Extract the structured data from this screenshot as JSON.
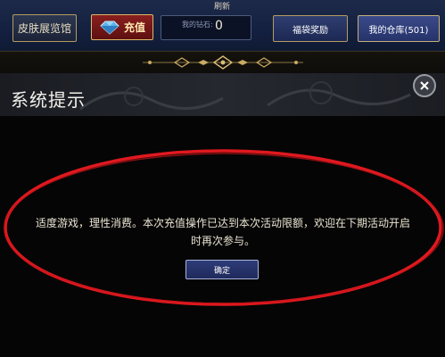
{
  "topbar": {
    "refresh_label": "刷新",
    "skin_hall_label": "皮肤展览馆",
    "recharge_label": "充值",
    "diamond_label": "我的钻石:",
    "diamond_value": "0",
    "lucky_bag_label": "福袋奖励",
    "warehouse_label": "我的仓库(501)"
  },
  "dialog": {
    "title": "系统提示",
    "message": "适度游戏，理性消费。本次充值操作已达到本次活动限额，欢迎在下期活动开启时再次参与。",
    "confirm_label": "确定"
  },
  "colors": {
    "accent_gold": "#b59c60",
    "recharge_red": "#8a1f1f",
    "highlight_ellipse": "#e0191f"
  }
}
